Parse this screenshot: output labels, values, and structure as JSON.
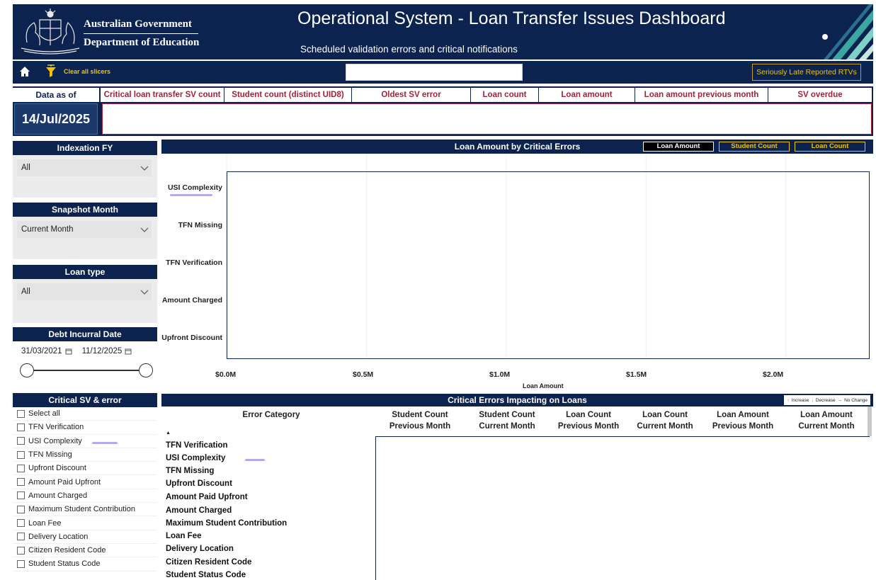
{
  "header": {
    "gov_line1": "Australian Government",
    "gov_line2": "Department of Education",
    "title": "Operational System - Loan Transfer Issues Dashboard",
    "subtitle": "Scheduled validation errors and critical notifications"
  },
  "toolbar": {
    "clear_slicers": "Clear all slicers",
    "search_value": "",
    "late_button": "Seriously Late Reported RTVs"
  },
  "kpis": {
    "data_as_of_label": "Data as of",
    "data_as_of_value": "14/Jul/2025",
    "headers": [
      "Critical loan transfer SV count",
      "Student count (distinct UID8)",
      "Oldest SV error",
      "Loan count",
      "Loan amount",
      "Loan amount previous month",
      "SV overdue"
    ]
  },
  "slicers": {
    "indexation": {
      "title": "Indexation FY",
      "value": "All"
    },
    "snapshot": {
      "title": "Snapshot Month",
      "value": "Current Month"
    },
    "loan_type": {
      "title": "Loan type",
      "value": "All"
    },
    "debt_date": {
      "title": "Debt Incurral Date",
      "start": "31/03/2021",
      "end": "11/12/2025"
    },
    "critical_sv": {
      "title": "Critical SV & error",
      "items": [
        "Select all",
        "TFN Verification",
        "USI Complexity",
        "TFN Missing",
        "Upfront Discount",
        "Amount Paid Upfront",
        "Amount Charged",
        "Maximum Student Contribution",
        "Loan Fee",
        "Delivery Location",
        "Citizen Resident Code",
        "Student Status Code"
      ]
    }
  },
  "chart": {
    "title": "Loan Amount by Critical Errors",
    "toggles": [
      "Loan Amount",
      "Student Count",
      "Loan Count"
    ]
  },
  "chart_data": {
    "type": "bar",
    "orientation": "horizontal",
    "categories": [
      "USI Complexity",
      "TFN Missing",
      "TFN Verification",
      "Amount Charged",
      "Upfront Discount"
    ],
    "values": [
      null,
      null,
      null,
      null,
      null
    ],
    "xlabel": "Loan Amount",
    "x_tick_labels": [
      "$0.0M",
      "$0.5M",
      "$1.0M",
      "$1.5M",
      "$2.0M"
    ],
    "xlim": [
      0,
      2.3
    ],
    "grid": true
  },
  "table": {
    "title": "Critical Errors Impacting on Loans",
    "legend": {
      "increase": "Increase",
      "decrease": "Decrease",
      "no_change": "No Change"
    },
    "columns": [
      [
        "Error Category",
        ""
      ],
      [
        "Student Count",
        "Previous Month"
      ],
      [
        "Student Count",
        "Current Month"
      ],
      [
        "Loan Count",
        "Previous Month"
      ],
      [
        "Loan Count",
        "Current Month"
      ],
      [
        "Loan Amount",
        "Previous Month"
      ],
      [
        "Loan Amount",
        "Current Month"
      ]
    ],
    "rows": [
      "TFN Verification",
      "USI Complexity",
      "TFN Missing",
      "Upfront Discount",
      "Amount Paid Upfront",
      "Amount Charged",
      "Maximum Student Contribution",
      "Loan Fee",
      "Delivery Location",
      "Citizen Resident Code",
      "Student Status Code"
    ]
  },
  "colors": {
    "navy": "#0c2350",
    "gold": "#f2c300",
    "kpi_red": "#a3223a",
    "highlight": "#a59ee8"
  }
}
